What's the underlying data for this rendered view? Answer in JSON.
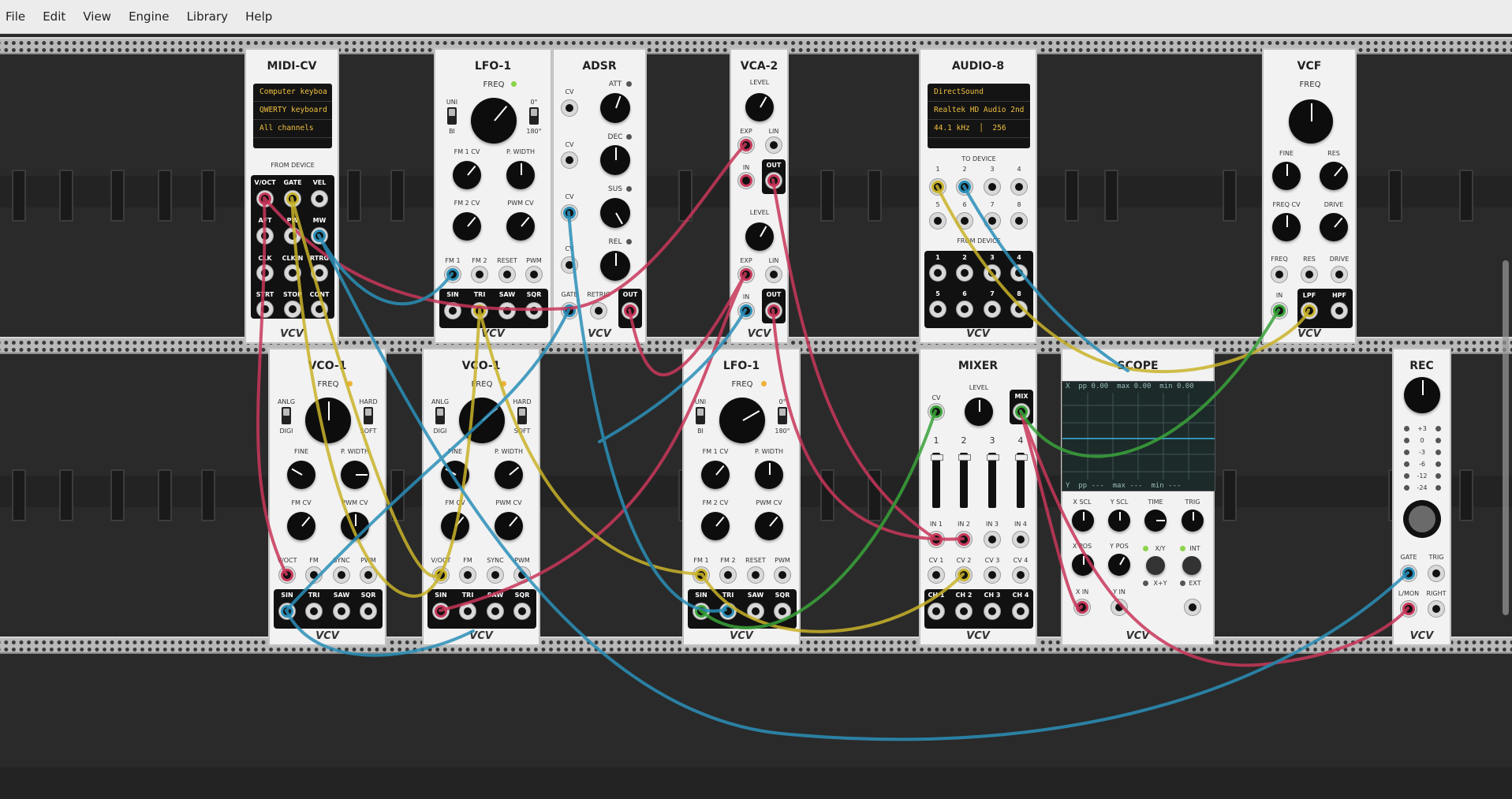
{
  "menu": [
    "File",
    "Edit",
    "View",
    "Engine",
    "Library",
    "Help"
  ],
  "brand": "VCV",
  "colors": {
    "red": "#c8375a",
    "yellow": "#c9b32a",
    "blue": "#2b8fb8",
    "green": "#3aa33a",
    "panel": "#f2f2f2"
  },
  "midicv": {
    "title": "MIDI-CV",
    "display": [
      "Computer keyboa",
      "QWERTY keyboard",
      "All channels"
    ],
    "section": "FROM DEVICE",
    "jacks": [
      "V/OCT",
      "GATE",
      "VEL",
      "AFT",
      "PW",
      "MW",
      "CLK",
      "CLK/N",
      "RTRG",
      "STRT",
      "STOP",
      "CONT"
    ]
  },
  "lfo1a": {
    "title": "LFO-1",
    "freq": "FREQ",
    "uni": "UNI",
    "bi": "BI",
    "deg0": "0°",
    "deg180": "180°",
    "fm1cv": "FM 1 CV",
    "pwidth": "P. WIDTH",
    "fm2cv": "FM 2 CV",
    "pwmcv": "PWM CV",
    "inputs": [
      "FM 1",
      "FM 2",
      "RESET",
      "PWM"
    ],
    "outputs": [
      "SIN",
      "TRI",
      "SAW",
      "SQR"
    ]
  },
  "adsr": {
    "title": "ADSR",
    "att": "ATT",
    "dec": "DEC",
    "sus": "SUS",
    "rel": "REL",
    "cv": "CV",
    "gate": "GATE",
    "retrig": "RETRIG",
    "out": "OUT"
  },
  "vca2": {
    "title": "VCA-2",
    "level": "LEVEL",
    "exp": "EXP",
    "lin": "LIN",
    "in": "IN",
    "out": "OUT"
  },
  "audio8": {
    "title": "AUDIO-8",
    "display": [
      "DirectSound",
      "Realtek HD Audio 2nd",
      "44.1 kHz",
      "256"
    ],
    "to_device": "TO DEVICE",
    "from_device": "FROM DEVICE",
    "nums": [
      "1",
      "2",
      "3",
      "4",
      "5",
      "6",
      "7",
      "8"
    ]
  },
  "vcf": {
    "title": "VCF",
    "freq": "FREQ",
    "fine": "FINE",
    "res": "RES",
    "freqcv": "FREQ CV",
    "drive": "DRIVE",
    "inputs": [
      "FREQ",
      "RES",
      "DRIVE"
    ],
    "in": "IN",
    "lpf": "LPF",
    "hpf": "HPF"
  },
  "vco1a": {
    "title": "VCO-1",
    "freq": "FREQ",
    "anlg": "ANLG",
    "digi": "DIGI",
    "hard": "HARD",
    "soft": "SOFT",
    "fine": "FINE",
    "pwidth": "P. WIDTH",
    "fmcv": "FM CV",
    "pwmcv": "PWM CV",
    "inputs": [
      "V/OCT",
      "FM",
      "SYNC",
      "PWM"
    ],
    "outputs": [
      "SIN",
      "TRI",
      "SAW",
      "SQR"
    ]
  },
  "vco1b": {
    "title": "VCO-1"
  },
  "lfo1b": {
    "title": "LFO-1"
  },
  "mixer": {
    "title": "MIXER",
    "cv": "CV",
    "level": "LEVEL",
    "mix": "MIX",
    "channels": [
      "1",
      "2",
      "3",
      "4"
    ],
    "ins": [
      "IN 1",
      "IN 2",
      "IN 3",
      "IN 4"
    ],
    "cvs": [
      "CV 1",
      "CV 2",
      "CV 3",
      "CV 4"
    ],
    "outs": [
      "CH 1",
      "CH 2",
      "CH 3",
      "CH 4"
    ]
  },
  "scope": {
    "title": "SCOPE",
    "top": [
      "X",
      "pp",
      "0.00",
      "max",
      "0.00",
      "min",
      "0.00"
    ],
    "bottom": [
      "Y",
      "pp",
      "---",
      "max",
      "---",
      "min",
      "---"
    ],
    "knobs": [
      "X SCL",
      "Y SCL",
      "TIME",
      "TRIG",
      "X POS",
      "Y POS"
    ],
    "xy": "X/Y",
    "xpy": "X+Y",
    "int": "INT",
    "ext": "EXT",
    "xin": "X IN",
    "yin": "Y IN"
  },
  "rec": {
    "title": "REC",
    "meter": [
      "+3",
      "0",
      "-3",
      "-6",
      "-12",
      "-24"
    ],
    "gate": "GATE",
    "trig": "TRIG",
    "lmon": "L/MON",
    "right": "RIGHT"
  }
}
